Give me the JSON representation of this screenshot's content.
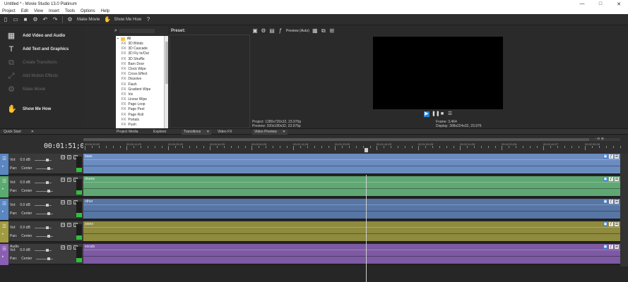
{
  "window": {
    "title": "Untitled * - Movie Studio 13.0 Platinum",
    "min": "—",
    "max": "□",
    "close": "✕"
  },
  "menu": [
    "Project",
    "Edit",
    "View",
    "Insert",
    "Tools",
    "Options",
    "Help"
  ],
  "toolbar": {
    "make_movie": "Make Movie",
    "show_me_how": "Show Me How"
  },
  "quickstart": {
    "items": [
      {
        "label": "Add Video and Audio",
        "icon": "film-add-icon",
        "enabled": true
      },
      {
        "label": "Add Text and Graphics",
        "icon": "text-add-icon",
        "enabled": true
      },
      {
        "label": "Create Transitions",
        "icon": "transition-icon",
        "enabled": false
      },
      {
        "label": "Add Motion Effects",
        "icon": "motion-icon",
        "enabled": false
      },
      {
        "label": "Make Movie",
        "icon": "make-movie-icon",
        "enabled": false
      },
      {
        "label": "Show Me How",
        "icon": "help-icon",
        "enabled": true
      }
    ]
  },
  "media": {
    "root": "All",
    "items": [
      "3D Blinds",
      "3D Cascade",
      "3D Fly In/Out",
      "3D Shuffle",
      "Barn Door",
      "Clock Wipe",
      "Cross Effect",
      "Dissolve",
      "Flash",
      "Gradient Wipe",
      "Iris",
      "Linear Wipe",
      "Page Loop",
      "Page Peel",
      "Page Roll",
      "Portals",
      "Push"
    ],
    "tag": "FX",
    "preset_label": "Preset:"
  },
  "preview": {
    "mode": "Preview (Auto)",
    "project": "Project:",
    "project_val": "1280x720x32, 23.976p",
    "preview_label": "Preview:",
    "preview_val": "320x180x32, 23.976p",
    "frame_label": "Frame:",
    "frame_val": "3,464",
    "display_label": "Display:",
    "display_val": "398x224x32, 23.976"
  },
  "tabs": [
    {
      "label": "Quick Start"
    },
    {
      "label": "Project Media"
    },
    {
      "label": "Explorer"
    },
    {
      "label": "Transitions"
    },
    {
      "label": "Video FX"
    },
    {
      "label": "Video Preview"
    }
  ],
  "timeline": {
    "timecode": "00:01:51;03",
    "ruler": [
      "00:00:00;00",
      "00:00:14;29",
      "00:00:29;29",
      "00:00:44;29",
      "00:00:59;28",
      "00:01:14;28",
      "00:01:29;29",
      "00:01:44;29",
      "00:01:59;28",
      "00:02:14;28",
      "00:02:29;28",
      "00:02:44;27",
      "00:02:59;28"
    ],
    "tracks": [
      {
        "type": "video",
        "name": "",
        "clip": "bass",
        "color": "#6b8cc0",
        "head": "#5a86c2",
        "vol": "0.0 dB",
        "pan": "Center"
      },
      {
        "type": "video",
        "name": "",
        "clip": "drums",
        "color": "#5fa874",
        "head": "#5aab6f",
        "vol": "0.0 dB",
        "pan": "Center"
      },
      {
        "type": "video",
        "name": "",
        "clip": "other",
        "color": "#5776a5",
        "head": "#5a86c2",
        "vol": "0.0 dB",
        "pan": "Center"
      },
      {
        "type": "video",
        "name": "",
        "clip": "piano",
        "color": "#8e8a3e",
        "head": "#a19b3f",
        "vol": "0.0 dB",
        "pan": "Center"
      },
      {
        "type": "audio",
        "name": "Audio",
        "clip": "vocals",
        "color": "#7d5aa3",
        "head": "#8a5fb3",
        "vol": "0.0 dB",
        "pan": "Center"
      }
    ],
    "vol_label": "Vol:",
    "pan_label": "Pan:",
    "zoom": "◦ ⊖ ⊕"
  }
}
